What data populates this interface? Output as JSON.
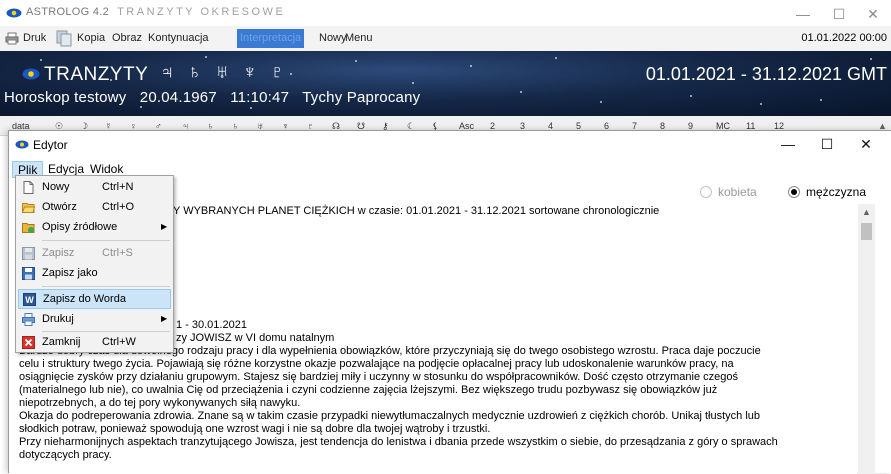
{
  "main_window": {
    "title": "ASTROLOG 4.2",
    "subtitle": "TRANZYTY OKRESOWE",
    "controls": {
      "minimize": "—",
      "maximize": "☐",
      "close": "✕"
    }
  },
  "main_menu": {
    "items": [
      "Druk",
      "Kopia",
      "Obraz",
      "Kontynuacja",
      "Interpretacja",
      "Nowy",
      "Menu"
    ],
    "active_item": "Interpretacja",
    "date": "01.01.2022 00:00"
  },
  "banner": {
    "title": "TRANZYTY",
    "planet_glyphs": "♃ ♄ ♅ ♆ ♇",
    "date_range": "01.01.2021 - 31.12.2021 GMT",
    "horoscope": "Horoskop testowy",
    "birth_date": "20.04.1967",
    "birth_time": "11:10:47",
    "place": "Tychy Paprocany"
  },
  "column_header": {
    "cols": [
      "data",
      "☉",
      "☽",
      "☿",
      "♀",
      "♂",
      "♃",
      "♄",
      "♄",
      "♅",
      "♆",
      "♇",
      "☊",
      "☋",
      "⚷",
      "☾",
      "⚸",
      "Asc",
      "2",
      "3",
      "4",
      "5",
      "6",
      "7",
      "8",
      "9",
      "MC",
      "11",
      "12"
    ]
  },
  "editor": {
    "title": "Edytor",
    "controls": {
      "minimize": "—",
      "maximize": "☐",
      "close": "✕"
    },
    "menu": [
      "Plik",
      "Edycja",
      "Widok"
    ],
    "open_menu": "Plik",
    "gender": {
      "female": "kobieta",
      "male": "mężczyzna",
      "selected": "mężczyzna"
    },
    "text_lines": [
      "Y WYBRANYCH PLANET CIĘŻKICH  w czasie: 01.01.2021 - 31.12.2021  sortowane chronologicznie",
      "1 - 30.01.2021",
      "zy JOWISZ w VI domu natalnym",
      "    Bardzo dobry czas dla dowolnego rodzaju pracy i dla wypełnienia obowiązków, które przyczyniają się do twego osobistego wzrostu. Praca daje poczucie",
      "celu i struktury twego życia. Pojawiają się różne korzystne okazje pozwalające na podjęcie opłacalnej pracy lub udoskonalenie warunków pracy, na",
      "osiągnięcie zysków przy działaniu grupowym. Stajesz się bardziej miły i uczynny w stosunku do współpracowników. Dość często otrzymanie czegoś",
      "(materialnego lub nie), co uwalnia Cię od przeciążenia i czyni codzienne zajęcia lżejszymi. Bez większego trudu pozbywasz się obowiązków już",
      "niepotrzebnych, a do tej pory wykonywanych siłą nawyku.",
      "  Okazja do podreperowania zdrowia. Znane są w takim czasie przypadki niewytłumaczalnych medycznie uzdrowień z ciężkich chorób. Unikaj tłustych lub",
      "słodkich potraw, ponieważ spowodują one wzrost wagi i nie są dobre dla twojej wątroby i trzustki.",
      "  Przy nieharmonijnych aspektach tranzytującego Jowisza, jest tendencja do lenistwa i dbania przede wszystkim o siebie, do przesądzania z góry o sprawach",
      "dotyczących pracy."
    ]
  },
  "plik_menu": {
    "items": [
      {
        "label": "Nowy",
        "shortcut": "Ctrl+N",
        "icon": "new-document-icon",
        "enabled": true
      },
      {
        "label": "Otwórz",
        "shortcut": "Ctrl+O",
        "icon": "open-folder-icon",
        "enabled": true
      },
      {
        "label": "Opisy źródłowe",
        "shortcut": "",
        "icon": "source-folder-icon",
        "enabled": true,
        "submenu": true
      },
      {
        "label": "Zapisz",
        "shortcut": "Ctrl+S",
        "icon": "save-icon",
        "enabled": false
      },
      {
        "label": "Zapisz jako",
        "shortcut": "",
        "icon": "save-as-icon",
        "enabled": true
      },
      {
        "label": "Zapisz do Worda",
        "shortcut": "",
        "icon": "word-icon",
        "enabled": true,
        "highlighted": true
      },
      {
        "label": "Drukuj",
        "shortcut": "",
        "icon": "printer-icon",
        "enabled": true,
        "submenu": true
      },
      {
        "label": "Zamknij",
        "shortcut": "Ctrl+W",
        "icon": "close-red-icon",
        "enabled": true
      }
    ]
  },
  "colors": {
    "accent": "#3a7ad3",
    "banner_dark": "#081428",
    "menu_highlight": "#cce4f7",
    "word_blue": "#2b579a",
    "close_red": "#d9342b"
  }
}
